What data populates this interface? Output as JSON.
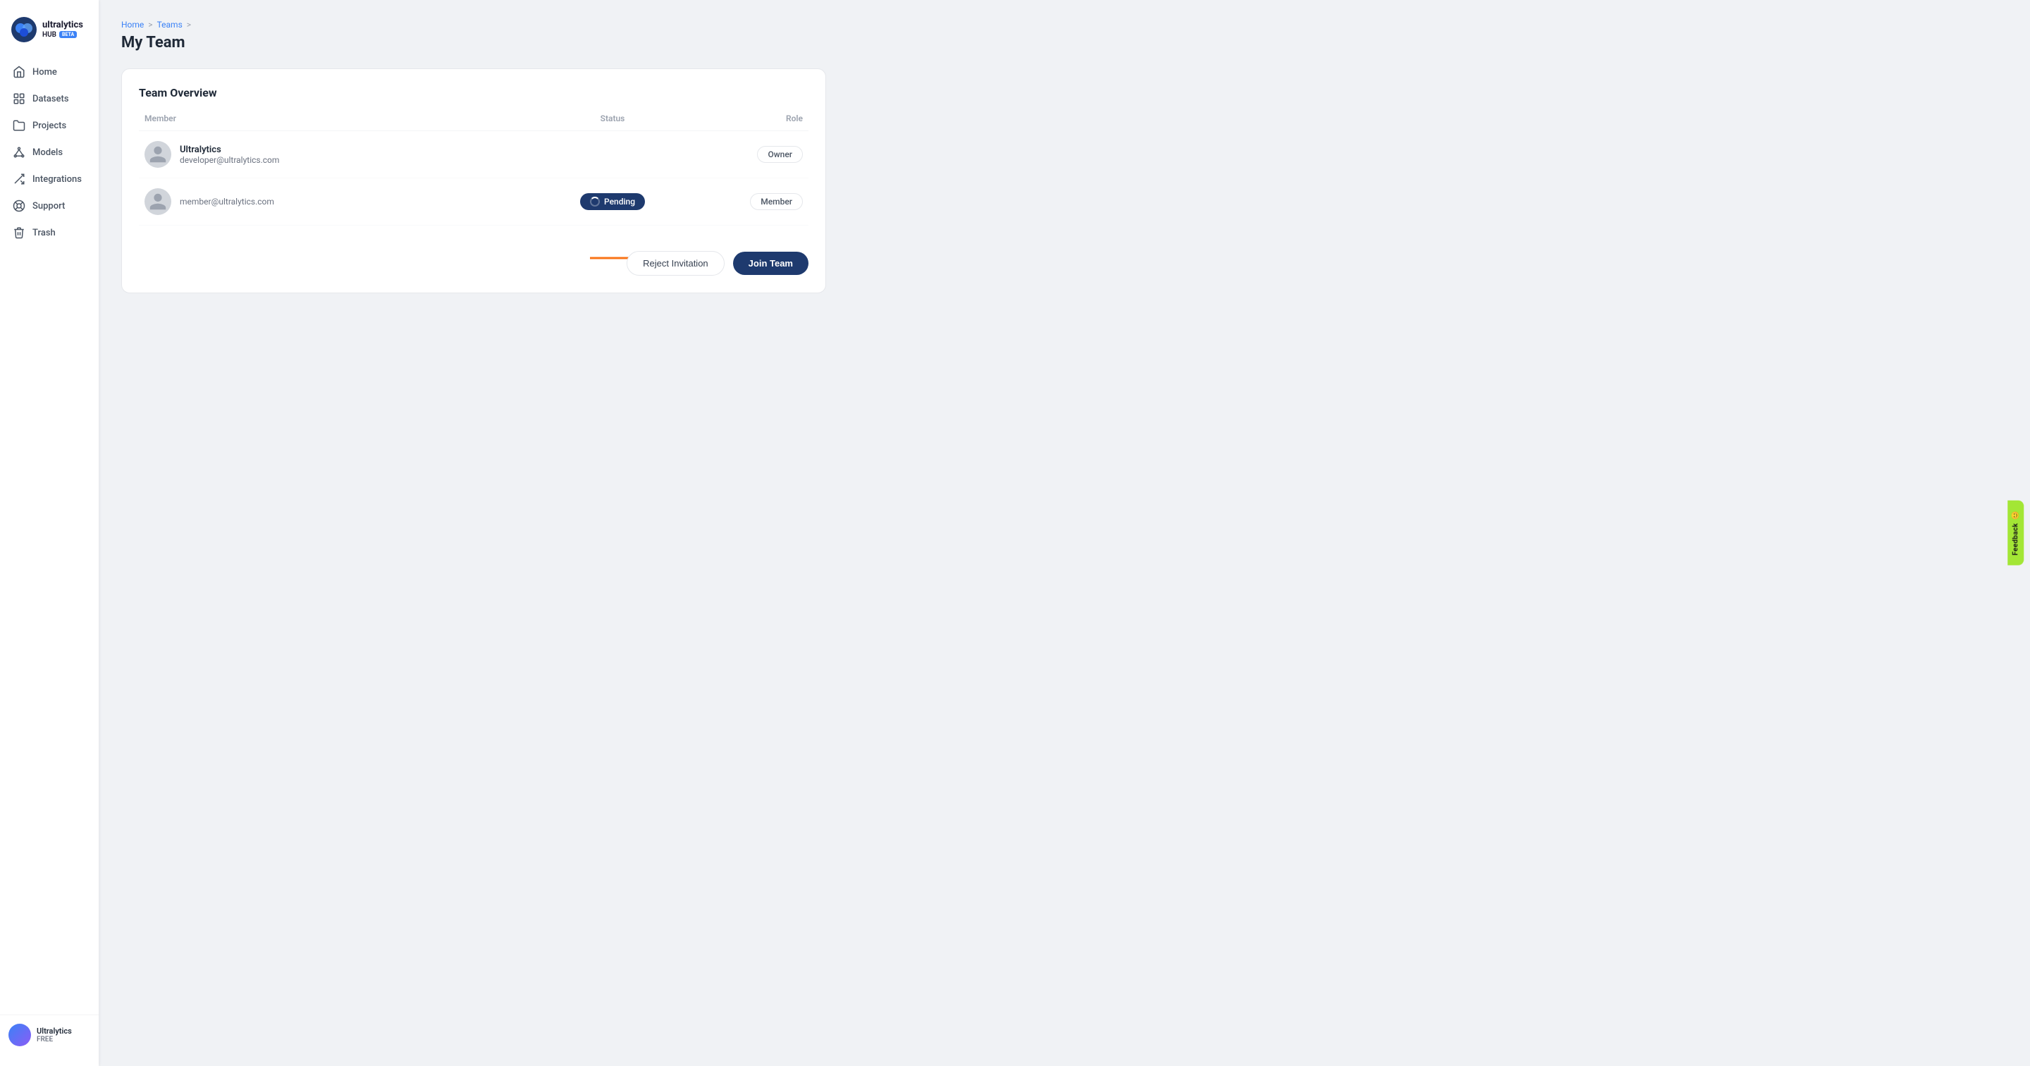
{
  "sidebar": {
    "logo": {
      "name": "ultralytics",
      "hub": "HUB",
      "beta": "BETA"
    },
    "nav_items": [
      {
        "id": "home",
        "label": "Home",
        "icon": "home"
      },
      {
        "id": "datasets",
        "label": "Datasets",
        "icon": "datasets"
      },
      {
        "id": "projects",
        "label": "Projects",
        "icon": "projects"
      },
      {
        "id": "models",
        "label": "Models",
        "icon": "models"
      },
      {
        "id": "integrations",
        "label": "Integrations",
        "icon": "integrations"
      },
      {
        "id": "support",
        "label": "Support",
        "icon": "support"
      },
      {
        "id": "trash",
        "label": "Trash",
        "icon": "trash"
      }
    ],
    "user": {
      "name": "Ultralytics",
      "plan": "FREE"
    }
  },
  "breadcrumb": {
    "items": [
      "Home",
      "Teams"
    ],
    "separators": [
      ">",
      ">"
    ]
  },
  "page_title": "My Team",
  "card": {
    "title": "Team Overview",
    "table": {
      "headers": [
        "Member",
        "Status",
        "Role"
      ],
      "rows": [
        {
          "name": "Ultralytics",
          "email": "developer@ultralytics.com",
          "status": "",
          "role": "Owner"
        },
        {
          "name": "",
          "email": "member@ultralytics.com",
          "status": "Pending",
          "role": "Member"
        }
      ]
    },
    "actions": {
      "reject_label": "Reject Invitation",
      "join_label": "Join Team"
    }
  },
  "feedback": {
    "label": "Feedback"
  },
  "colors": {
    "primary": "#1e3a6e",
    "accent": "#3b82f6",
    "pending_bg": "#1e3a6e",
    "arrow_color": "#f97316"
  }
}
